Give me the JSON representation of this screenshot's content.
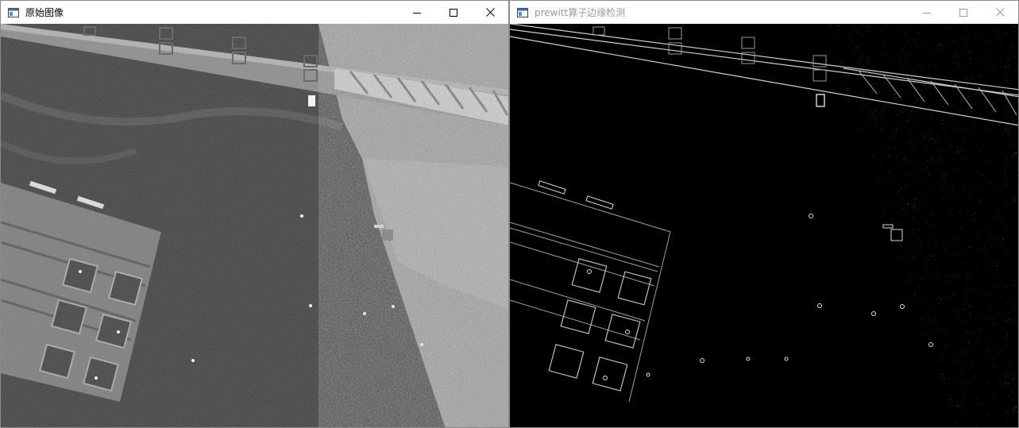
{
  "left_window": {
    "title": "原始图像",
    "icon": "window-app-icon",
    "controls": [
      "minimize-icon",
      "maximize-icon",
      "close-icon"
    ]
  },
  "right_window": {
    "title": "prewitt算子边缘检测",
    "icon": "window-app-icon",
    "controls": [
      "minimize-icon",
      "maximize-icon",
      "close-icon"
    ]
  },
  "colors": {
    "titlebar_bg": "#ffffff",
    "active_title": "#000000",
    "inactive_title": "#9a9a9a",
    "image_bg": "#000000"
  }
}
